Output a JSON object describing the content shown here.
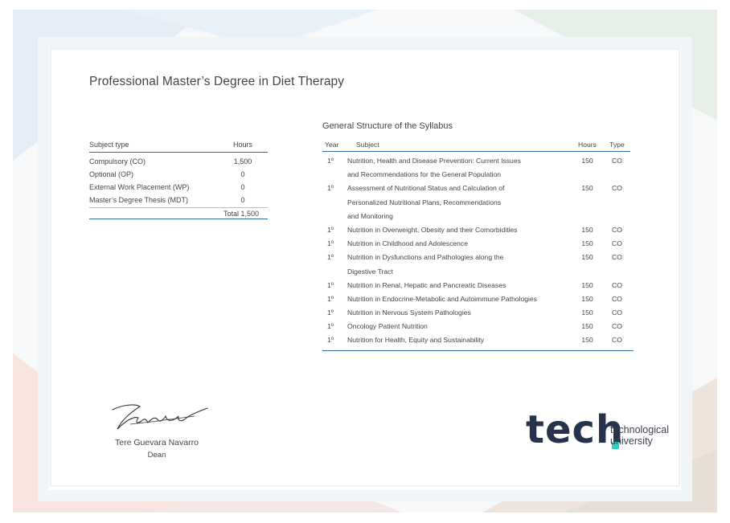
{
  "document": {
    "title": "Professional Master’s Degree in Diet Therapy"
  },
  "summary": {
    "headers": {
      "type": "Subject type",
      "hours": "Hours"
    },
    "rows": [
      {
        "type": "Compulsory (CO)",
        "hours": "1,500"
      },
      {
        "type": "Optional (OP)",
        "hours": "0"
      },
      {
        "type": "External Work Placement (WP)",
        "hours": "0"
      },
      {
        "type": "Master’s Degree Thesis (MDT)",
        "hours": "0"
      }
    ],
    "total": "Total 1,500"
  },
  "syllabus": {
    "title": "General Structure of the Syllabus",
    "headers": {
      "year": "Year",
      "subject": "Subject",
      "hours": "Hours",
      "type": "Type"
    },
    "rows": [
      {
        "year": "1º",
        "subject": [
          "Nutrition, Health and Disease Prevention: Current Issues",
          "and Recommendations for the General Population"
        ],
        "hours": "150",
        "type": "CO"
      },
      {
        "year": "1º",
        "subject": [
          "Assessment of Nutritional Status and Calculation of",
          "Personalized Nutritional Plans, Recommendations",
          "and Monitoring"
        ],
        "hours": "150",
        "type": "CO"
      },
      {
        "year": "1º",
        "subject": [
          "Nutrition in Overweight, Obesity and their Comorbidities"
        ],
        "hours": "150",
        "type": "CO"
      },
      {
        "year": "1º",
        "subject": [
          "Nutrition in Childhood and Adolescence"
        ],
        "hours": "150",
        "type": "CO"
      },
      {
        "year": "1º",
        "subject": [
          "Nutrition in Dysfunctions and Pathologies along the",
          "Digestive Tract"
        ],
        "hours": "150",
        "type": "CO"
      },
      {
        "year": "1º",
        "subject": [
          "Nutrition in Renal, Hepatic and Pancreatic Diseases"
        ],
        "hours": "150",
        "type": "CO"
      },
      {
        "year": "1º",
        "subject": [
          "Nutrition in Endocrine-Metabolic and Autoimmune Pathologies"
        ],
        "hours": "150",
        "type": "CO"
      },
      {
        "year": "1º",
        "subject": [
          "Nutrition in Nervous System Pathologies"
        ],
        "hours": "150",
        "type": "CO"
      },
      {
        "year": "1º",
        "subject": [
          "Oncology Patient Nutrition"
        ],
        "hours": "150",
        "type": "CO"
      },
      {
        "year": "1º",
        "subject": [
          "Nutrition for Health, Equity and Sustainability"
        ],
        "hours": "150",
        "type": "CO"
      }
    ]
  },
  "signature": {
    "name": "Tere Guevara Navarro",
    "role": "Dean"
  },
  "logo": {
    "word": "tech",
    "line1": "technological",
    "line2": "university",
    "accent_color": "#2fd1c0",
    "brand_color": "#27334d"
  },
  "colors": {
    "rule": "#2f6fa8"
  }
}
